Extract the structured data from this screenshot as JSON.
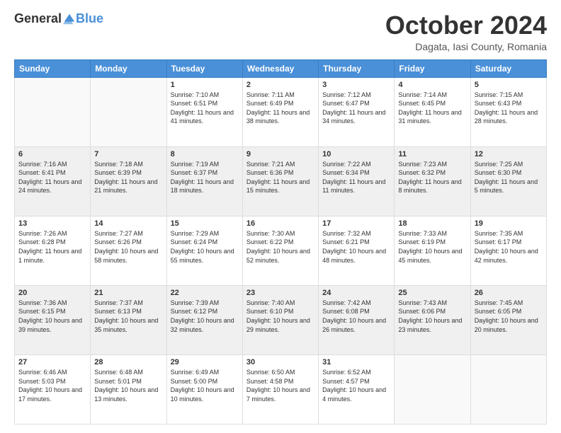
{
  "header": {
    "logo_general": "General",
    "logo_blue": "Blue",
    "month": "October 2024",
    "location": "Dagata, Iasi County, Romania"
  },
  "days_of_week": [
    "Sunday",
    "Monday",
    "Tuesday",
    "Wednesday",
    "Thursday",
    "Friday",
    "Saturday"
  ],
  "weeks": [
    [
      {
        "day": "",
        "info": ""
      },
      {
        "day": "",
        "info": ""
      },
      {
        "day": "1",
        "info": "Sunrise: 7:10 AM\nSunset: 6:51 PM\nDaylight: 11 hours and 41 minutes."
      },
      {
        "day": "2",
        "info": "Sunrise: 7:11 AM\nSunset: 6:49 PM\nDaylight: 11 hours and 38 minutes."
      },
      {
        "day": "3",
        "info": "Sunrise: 7:12 AM\nSunset: 6:47 PM\nDaylight: 11 hours and 34 minutes."
      },
      {
        "day": "4",
        "info": "Sunrise: 7:14 AM\nSunset: 6:45 PM\nDaylight: 11 hours and 31 minutes."
      },
      {
        "day": "5",
        "info": "Sunrise: 7:15 AM\nSunset: 6:43 PM\nDaylight: 11 hours and 28 minutes."
      }
    ],
    [
      {
        "day": "6",
        "info": "Sunrise: 7:16 AM\nSunset: 6:41 PM\nDaylight: 11 hours and 24 minutes."
      },
      {
        "day": "7",
        "info": "Sunrise: 7:18 AM\nSunset: 6:39 PM\nDaylight: 11 hours and 21 minutes."
      },
      {
        "day": "8",
        "info": "Sunrise: 7:19 AM\nSunset: 6:37 PM\nDaylight: 11 hours and 18 minutes."
      },
      {
        "day": "9",
        "info": "Sunrise: 7:21 AM\nSunset: 6:36 PM\nDaylight: 11 hours and 15 minutes."
      },
      {
        "day": "10",
        "info": "Sunrise: 7:22 AM\nSunset: 6:34 PM\nDaylight: 11 hours and 11 minutes."
      },
      {
        "day": "11",
        "info": "Sunrise: 7:23 AM\nSunset: 6:32 PM\nDaylight: 11 hours and 8 minutes."
      },
      {
        "day": "12",
        "info": "Sunrise: 7:25 AM\nSunset: 6:30 PM\nDaylight: 11 hours and 5 minutes."
      }
    ],
    [
      {
        "day": "13",
        "info": "Sunrise: 7:26 AM\nSunset: 6:28 PM\nDaylight: 11 hours and 1 minute."
      },
      {
        "day": "14",
        "info": "Sunrise: 7:27 AM\nSunset: 6:26 PM\nDaylight: 10 hours and 58 minutes."
      },
      {
        "day": "15",
        "info": "Sunrise: 7:29 AM\nSunset: 6:24 PM\nDaylight: 10 hours and 55 minutes."
      },
      {
        "day": "16",
        "info": "Sunrise: 7:30 AM\nSunset: 6:22 PM\nDaylight: 10 hours and 52 minutes."
      },
      {
        "day": "17",
        "info": "Sunrise: 7:32 AM\nSunset: 6:21 PM\nDaylight: 10 hours and 48 minutes."
      },
      {
        "day": "18",
        "info": "Sunrise: 7:33 AM\nSunset: 6:19 PM\nDaylight: 10 hours and 45 minutes."
      },
      {
        "day": "19",
        "info": "Sunrise: 7:35 AM\nSunset: 6:17 PM\nDaylight: 10 hours and 42 minutes."
      }
    ],
    [
      {
        "day": "20",
        "info": "Sunrise: 7:36 AM\nSunset: 6:15 PM\nDaylight: 10 hours and 39 minutes."
      },
      {
        "day": "21",
        "info": "Sunrise: 7:37 AM\nSunset: 6:13 PM\nDaylight: 10 hours and 35 minutes."
      },
      {
        "day": "22",
        "info": "Sunrise: 7:39 AM\nSunset: 6:12 PM\nDaylight: 10 hours and 32 minutes."
      },
      {
        "day": "23",
        "info": "Sunrise: 7:40 AM\nSunset: 6:10 PM\nDaylight: 10 hours and 29 minutes."
      },
      {
        "day": "24",
        "info": "Sunrise: 7:42 AM\nSunset: 6:08 PM\nDaylight: 10 hours and 26 minutes."
      },
      {
        "day": "25",
        "info": "Sunrise: 7:43 AM\nSunset: 6:06 PM\nDaylight: 10 hours and 23 minutes."
      },
      {
        "day": "26",
        "info": "Sunrise: 7:45 AM\nSunset: 6:05 PM\nDaylight: 10 hours and 20 minutes."
      }
    ],
    [
      {
        "day": "27",
        "info": "Sunrise: 6:46 AM\nSunset: 5:03 PM\nDaylight: 10 hours and 17 minutes."
      },
      {
        "day": "28",
        "info": "Sunrise: 6:48 AM\nSunset: 5:01 PM\nDaylight: 10 hours and 13 minutes."
      },
      {
        "day": "29",
        "info": "Sunrise: 6:49 AM\nSunset: 5:00 PM\nDaylight: 10 hours and 10 minutes."
      },
      {
        "day": "30",
        "info": "Sunrise: 6:50 AM\nSunset: 4:58 PM\nDaylight: 10 hours and 7 minutes."
      },
      {
        "day": "31",
        "info": "Sunrise: 6:52 AM\nSunset: 4:57 PM\nDaylight: 10 hours and 4 minutes."
      },
      {
        "day": "",
        "info": ""
      },
      {
        "day": "",
        "info": ""
      }
    ]
  ]
}
